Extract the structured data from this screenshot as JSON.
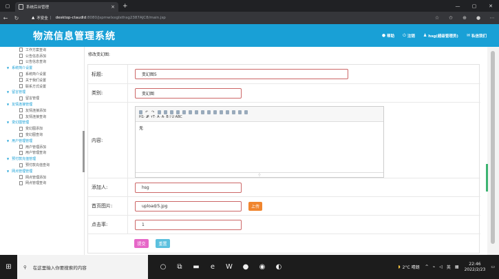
{
  "browser": {
    "tab_title": "系统后台管理",
    "url_warning": "不安全",
    "url_host": "desktop-ctaudld",
    "url_path": ":8080/jspmwlxxglxthsg2387AJC8/main.jsp"
  },
  "header": {
    "title": "物流信息管理系统",
    "help": "帮助",
    "logout": "注销",
    "user": "hsg(超级管理员)",
    "messages": "私信我们"
  },
  "sidebar": {
    "items": [
      {
        "type": "item",
        "label": "工作方案查询"
      },
      {
        "type": "item",
        "label": "公告信息添加"
      },
      {
        "type": "item",
        "label": "公告信息查询"
      },
      {
        "type": "group",
        "label": "系统简介设置"
      },
      {
        "type": "item",
        "label": "系统简介设置"
      },
      {
        "type": "item",
        "label": "关于我们设置"
      },
      {
        "type": "item",
        "label": "联系方式设置"
      },
      {
        "type": "group",
        "label": "留言管理"
      },
      {
        "type": "item",
        "label": "留言管理"
      },
      {
        "type": "group",
        "label": "友情连接管理"
      },
      {
        "type": "item",
        "label": "友情连接添加"
      },
      {
        "type": "item",
        "label": "友情连接查询"
      },
      {
        "type": "group",
        "label": "变幻图管理"
      },
      {
        "type": "item",
        "label": "变幻图添加"
      },
      {
        "type": "item",
        "label": "变幻图查询"
      },
      {
        "type": "group",
        "label": "用户管理管理"
      },
      {
        "type": "item",
        "label": "用户管理添加"
      },
      {
        "type": "item",
        "label": "用户管理查询"
      },
      {
        "type": "group",
        "label": "预付款充值管理"
      },
      {
        "type": "item",
        "label": "预付款充值查询"
      },
      {
        "type": "group",
        "label": "网点管理管理"
      },
      {
        "type": "item",
        "label": "网点管理添加"
      },
      {
        "type": "item",
        "label": "网点管理查询"
      }
    ]
  },
  "form": {
    "heading": "修改变幻图:",
    "title_label": "标题:",
    "title_value": "变幻图5",
    "category_label": "类别:",
    "category_value": "变幻图",
    "content_label": "内容:",
    "content_value": "无",
    "toolbar_row2": "H1·  𝓕·  тT·  A·  A·  B  I  U  ABC",
    "adder_label": "添加人:",
    "adder_value": "hsg",
    "image_label": "首页图片:",
    "image_value": "upload/5.jpg",
    "upload_button": "上传",
    "clicks_label": "点击率:",
    "clicks_value": "1",
    "submit_button": "提交",
    "reset_button": "重置"
  },
  "taskbar": {
    "search_placeholder": "在这里输入你要搜索的内容",
    "weather": "2°C 晴朗",
    "lang": "英",
    "time": "22:46",
    "date": "2022/2/23"
  },
  "colors": {
    "header": "#19a0d6",
    "upload": "#f0852e",
    "submit": "#e667c8",
    "reset": "#5bc0de"
  }
}
